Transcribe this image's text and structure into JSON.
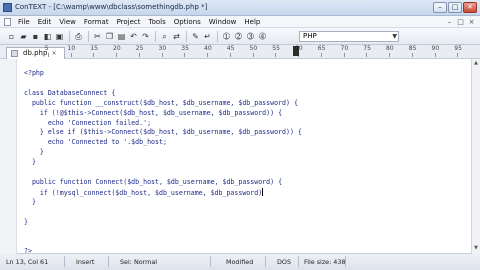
{
  "window": {
    "title": "ConTEXT - [C:\\wamp\\www\\dbclass\\somethingdb.php *]",
    "controls": [
      "–",
      "□",
      "✕"
    ]
  },
  "menu": {
    "items": [
      "File",
      "Edit",
      "View",
      "Format",
      "Project",
      "Tools",
      "Options",
      "Window",
      "Help"
    ],
    "right_controls": [
      "–",
      "□",
      "×"
    ]
  },
  "toolbar": {
    "icons": [
      "new-file-icon",
      "open-icon",
      "save-icon",
      "save-all-icon",
      "close-file-icon",
      "print-icon",
      "cut-icon",
      "copy-icon",
      "paste-icon",
      "undo-icon",
      "redo-icon",
      "find-icon",
      "replace-icon",
      "settings-icon",
      "word-wrap-icon",
      "run-1-icon",
      "run-2-icon",
      "run-3-icon",
      "run-4-icon"
    ],
    "language": "PHP"
  },
  "tab": {
    "label": "db.php",
    "close": "×"
  },
  "ruler": {
    "numbers": [
      "5",
      "10",
      "15",
      "20",
      "25",
      "30",
      "35",
      "40",
      "45",
      "50",
      "55",
      "60",
      "65",
      "70",
      "75",
      "80",
      "85",
      "90",
      "95"
    ]
  },
  "code": {
    "lines": [
      "<?php",
      "",
      "class DatabaseConnect {",
      "  public function __construct($db_host, $db_username, $db_password) {",
      "    if (!@$this->Connect($db_host, $db_username, $db_password)) {",
      "      echo 'Connection failed.';",
      "    } else if ($this->Connect($db_host, $db_username, $db_password)) {",
      "      echo 'Connected to '.$db_host;",
      "    }",
      "  }",
      "",
      "  public function Connect($db_host, $db_username, $db_password) {",
      "    if (!mysql_connect($db_host, $db_username, $db_password)",
      "  }",
      "",
      "}",
      "",
      "",
      "?>"
    ]
  },
  "status": {
    "position": "Ln 13, Col 61",
    "mode": "Insert",
    "selection": "Sel: Normal",
    "modified": "Modified",
    "format": "DOS",
    "file_size": "File size: 438"
  }
}
